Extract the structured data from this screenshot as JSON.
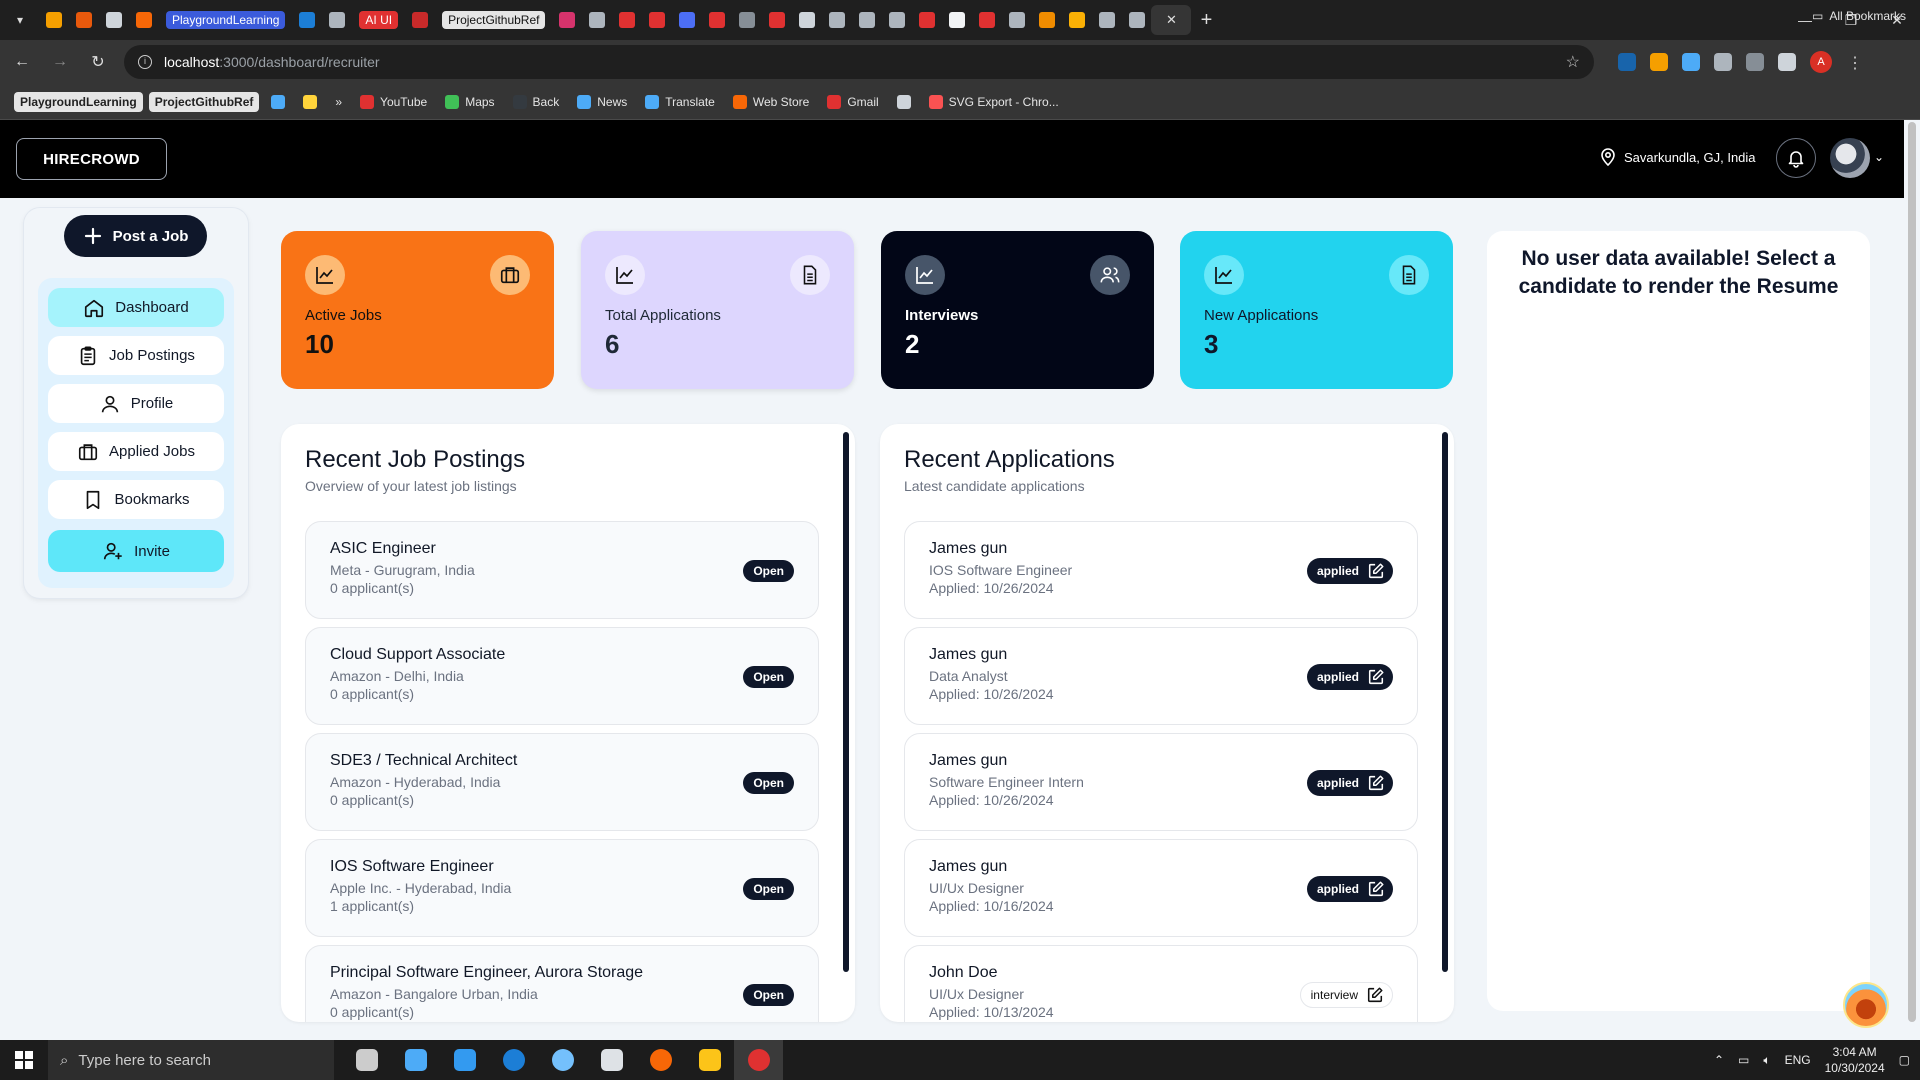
{
  "browser": {
    "tabs": [
      {
        "label": "",
        "color": "#f59f00"
      },
      {
        "label": "",
        "color": "#e8590c"
      },
      {
        "label": "",
        "color": "#ced4da"
      },
      {
        "label": "",
        "color": "#f76707"
      },
      {
        "label": "PlaygroundLearning",
        "color": "#3b5bdb",
        "style": "blue"
      },
      {
        "label": "",
        "color": "#1c7ed6"
      },
      {
        "label": "",
        "color": "#adb5bd"
      },
      {
        "label": "AI UI",
        "color": "#e03131",
        "style": "red"
      },
      {
        "label": "",
        "color": "#c92a2a"
      },
      {
        "label": "ProjectGithubRef",
        "color": "#e5e5e5",
        "style": "gray"
      },
      {
        "label": "",
        "color": "#d6336c"
      },
      {
        "label": "",
        "color": "#adb5bd"
      },
      {
        "label": "",
        "color": "#e03131"
      },
      {
        "label": "",
        "color": "#e03131"
      },
      {
        "label": "",
        "color": "#4c6ef5"
      },
      {
        "label": "",
        "color": "#e03131"
      },
      {
        "label": "",
        "color": "#868e96"
      },
      {
        "label": "",
        "color": "#e03131"
      },
      {
        "label": "",
        "color": "#ced4da"
      },
      {
        "label": "",
        "color": "#adb5bd"
      },
      {
        "label": "",
        "color": "#adb5bd"
      },
      {
        "label": "",
        "color": "#adb5bd"
      },
      {
        "label": "",
        "color": "#e03131"
      },
      {
        "label": "",
        "color": "#f1f3f5"
      },
      {
        "label": "",
        "color": "#e03131"
      },
      {
        "label": "",
        "color": "#adb5bd"
      },
      {
        "label": "",
        "color": "#f08c00"
      },
      {
        "label": "",
        "color": "#fab005"
      },
      {
        "label": "",
        "color": "#adb5bd"
      },
      {
        "label": "",
        "color": "#adb5bd"
      }
    ],
    "url_host": "localhost",
    "url_path": ":3000/dashboard/recruiter",
    "bookmarks": [
      {
        "label": "PlaygroundLearning",
        "pill": true
      },
      {
        "label": "ProjectGithubRef",
        "pill": true
      },
      {
        "label": "",
        "color": "#4dabf7"
      },
      {
        "label": "",
        "color": "#ffd43b"
      },
      {
        "label": "»"
      },
      {
        "label": "YouTube",
        "color": "#e03131"
      },
      {
        "label": "Maps",
        "color": "#40c057"
      },
      {
        "label": "Back",
        "color": "#343a40"
      },
      {
        "label": "News",
        "color": "#4dabf7"
      },
      {
        "label": "Translate",
        "color": "#4dabf7"
      },
      {
        "label": "Web Store",
        "color": "#f76707"
      },
      {
        "label": "Gmail",
        "color": "#e03131"
      },
      {
        "label": "",
        "color": "#ced4da"
      },
      {
        "label": "SVG Export - Chro...",
        "color": "#fa5252"
      }
    ],
    "all_bookmarks": "All Bookmarks",
    "profile_initial": "A"
  },
  "header": {
    "logo": "HIRECROWD",
    "location": "Savarkundla, GJ, India"
  },
  "sidebar": {
    "post_job": "Post a Job",
    "items": [
      {
        "label": "Dashboard",
        "icon": "home-icon",
        "active": true
      },
      {
        "label": "Job Postings",
        "icon": "clipboard-icon"
      },
      {
        "label": "Profile",
        "icon": "user-icon"
      },
      {
        "label": "Applied Jobs",
        "icon": "briefcase-icon"
      },
      {
        "label": "Bookmarks",
        "icon": "bookmark-icon"
      }
    ],
    "invite": "Invite"
  },
  "stats": [
    {
      "label": "Active Jobs",
      "value": "10",
      "right_icon": "briefcase-icon"
    },
    {
      "label": "Total Applications",
      "value": "6",
      "right_icon": "document-icon"
    },
    {
      "label": "Interviews",
      "value": "2",
      "right_icon": "users-icon"
    },
    {
      "label": "New Applications",
      "value": "3",
      "right_icon": "document-icon"
    }
  ],
  "recent_jobs": {
    "title": "Recent Job Postings",
    "subtitle": "Overview of your latest job listings",
    "items": [
      {
        "title": "ASIC Engineer",
        "company": "Meta - Gurugram, India",
        "count": "0 applicant(s)",
        "status": "Open"
      },
      {
        "title": "Cloud Support Associate",
        "company": "Amazon - Delhi, India",
        "count": "0 applicant(s)",
        "status": "Open"
      },
      {
        "title": "SDE3 / Technical Architect",
        "company": "Amazon - Hyderabad, India",
        "count": "0 applicant(s)",
        "status": "Open"
      },
      {
        "title": "IOS Software Engineer",
        "company": "Apple Inc. - Hyderabad, India",
        "count": "1 applicant(s)",
        "status": "Open"
      },
      {
        "title": "Principal Software Engineer, Aurora Storage",
        "company": "Amazon - Bangalore Urban, India",
        "count": "0 applicant(s)",
        "status": "Open"
      }
    ]
  },
  "recent_applications": {
    "title": "Recent Applications",
    "subtitle": "Latest candidate applications",
    "items": [
      {
        "name": "James gun",
        "role": "IOS Software Engineer",
        "date": "Applied: 10/26/2024",
        "status": "applied"
      },
      {
        "name": "James gun",
        "role": "Data Analyst",
        "date": "Applied: 10/26/2024",
        "status": "applied"
      },
      {
        "name": "James gun",
        "role": "Software Engineer Intern",
        "date": "Applied: 10/26/2024",
        "status": "applied"
      },
      {
        "name": "James gun",
        "role": "UI/Ux Designer",
        "date": "Applied: 10/16/2024",
        "status": "applied"
      },
      {
        "name": "John Doe",
        "role": "UI/Ux Designer",
        "date": "Applied: 10/13/2024",
        "status": "interview"
      }
    ]
  },
  "resume": {
    "message": "No user data available! Select a candidate to render the Resume"
  },
  "taskbar": {
    "search_placeholder": "Type here to search",
    "lang": "ENG",
    "time": "3:04 AM",
    "date": "10/30/2024",
    "apps": [
      {
        "name": "task-view-icon",
        "color": "#cccccc"
      },
      {
        "name": "copilot-icon",
        "color": "#4dabf7"
      },
      {
        "name": "store-icon",
        "color": "#339af0"
      },
      {
        "name": "edge-icon",
        "color": "#1c7ed6"
      },
      {
        "name": "app-icon",
        "color": "#74c0fc"
      },
      {
        "name": "terminal-icon",
        "color": "#dee2e6"
      },
      {
        "name": "firefox-icon",
        "color": "#f76707"
      },
      {
        "name": "explorer-icon",
        "color": "#fcc419"
      },
      {
        "name": "chrome-icon",
        "color": "#e03131"
      }
    ]
  }
}
